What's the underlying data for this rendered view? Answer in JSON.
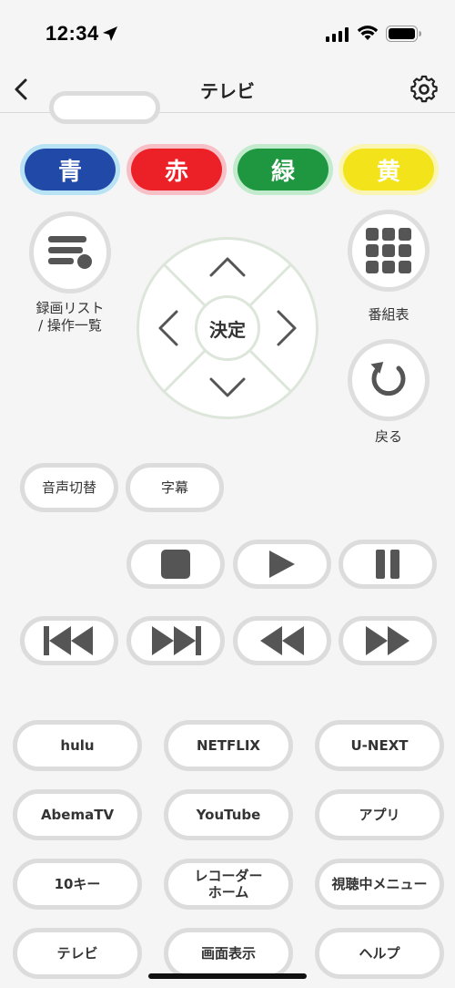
{
  "status_bar": {
    "time": "12:34"
  },
  "nav": {
    "title": "テレビ"
  },
  "color_buttons": [
    {
      "label": "青",
      "color": "#2149a8",
      "ring": "#b8e3f4"
    },
    {
      "label": "赤",
      "color": "#ec2027",
      "ring": "#f6c0c6"
    },
    {
      "label": "緑",
      "color": "#1f9740",
      "ring": "#c2ebcd"
    },
    {
      "label": "黄",
      "color": "#f2e31b",
      "ring": "#fbf5b3"
    }
  ],
  "recordings": {
    "label_line1": "録画リスト",
    "label_line2": "/ 操作一覧"
  },
  "guide": {
    "label": "番組表"
  },
  "back": {
    "label": "戻る"
  },
  "dpad": {
    "center_label": "決定"
  },
  "audio_button": {
    "label": "音声切替"
  },
  "subtitle_button": {
    "label": "字幕"
  },
  "services": {
    "row1": [
      "hulu",
      "NETFLIX",
      "U-NEXT"
    ],
    "row2": [
      "AbemaTV",
      "YouTube",
      "アプリ"
    ],
    "row3": [
      "10キー",
      "レコーダー\nホーム",
      "視聴中メニュー"
    ],
    "row4": [
      "テレビ",
      "画面表示",
      "ヘルプ"
    ]
  },
  "service_labels": {
    "hulu": "hulu",
    "netflix": "NETFLIX",
    "unext": "U-NEXT",
    "abema": "AbemaTV",
    "youtube": "YouTube",
    "apps": "アプリ",
    "tenkey": "10キー",
    "recorder_line1": "レコーダー",
    "recorder_line2": "ホーム",
    "watching_menu": "視聴中メニュー",
    "tv": "テレビ",
    "display": "画面表示",
    "help": "ヘルプ"
  },
  "icons": {
    "location": "location-arrow-icon",
    "signal": "cellular-signal-icon",
    "wifi": "wifi-icon",
    "battery": "battery-icon",
    "back": "chevron-left-icon",
    "settings": "gear-icon"
  }
}
